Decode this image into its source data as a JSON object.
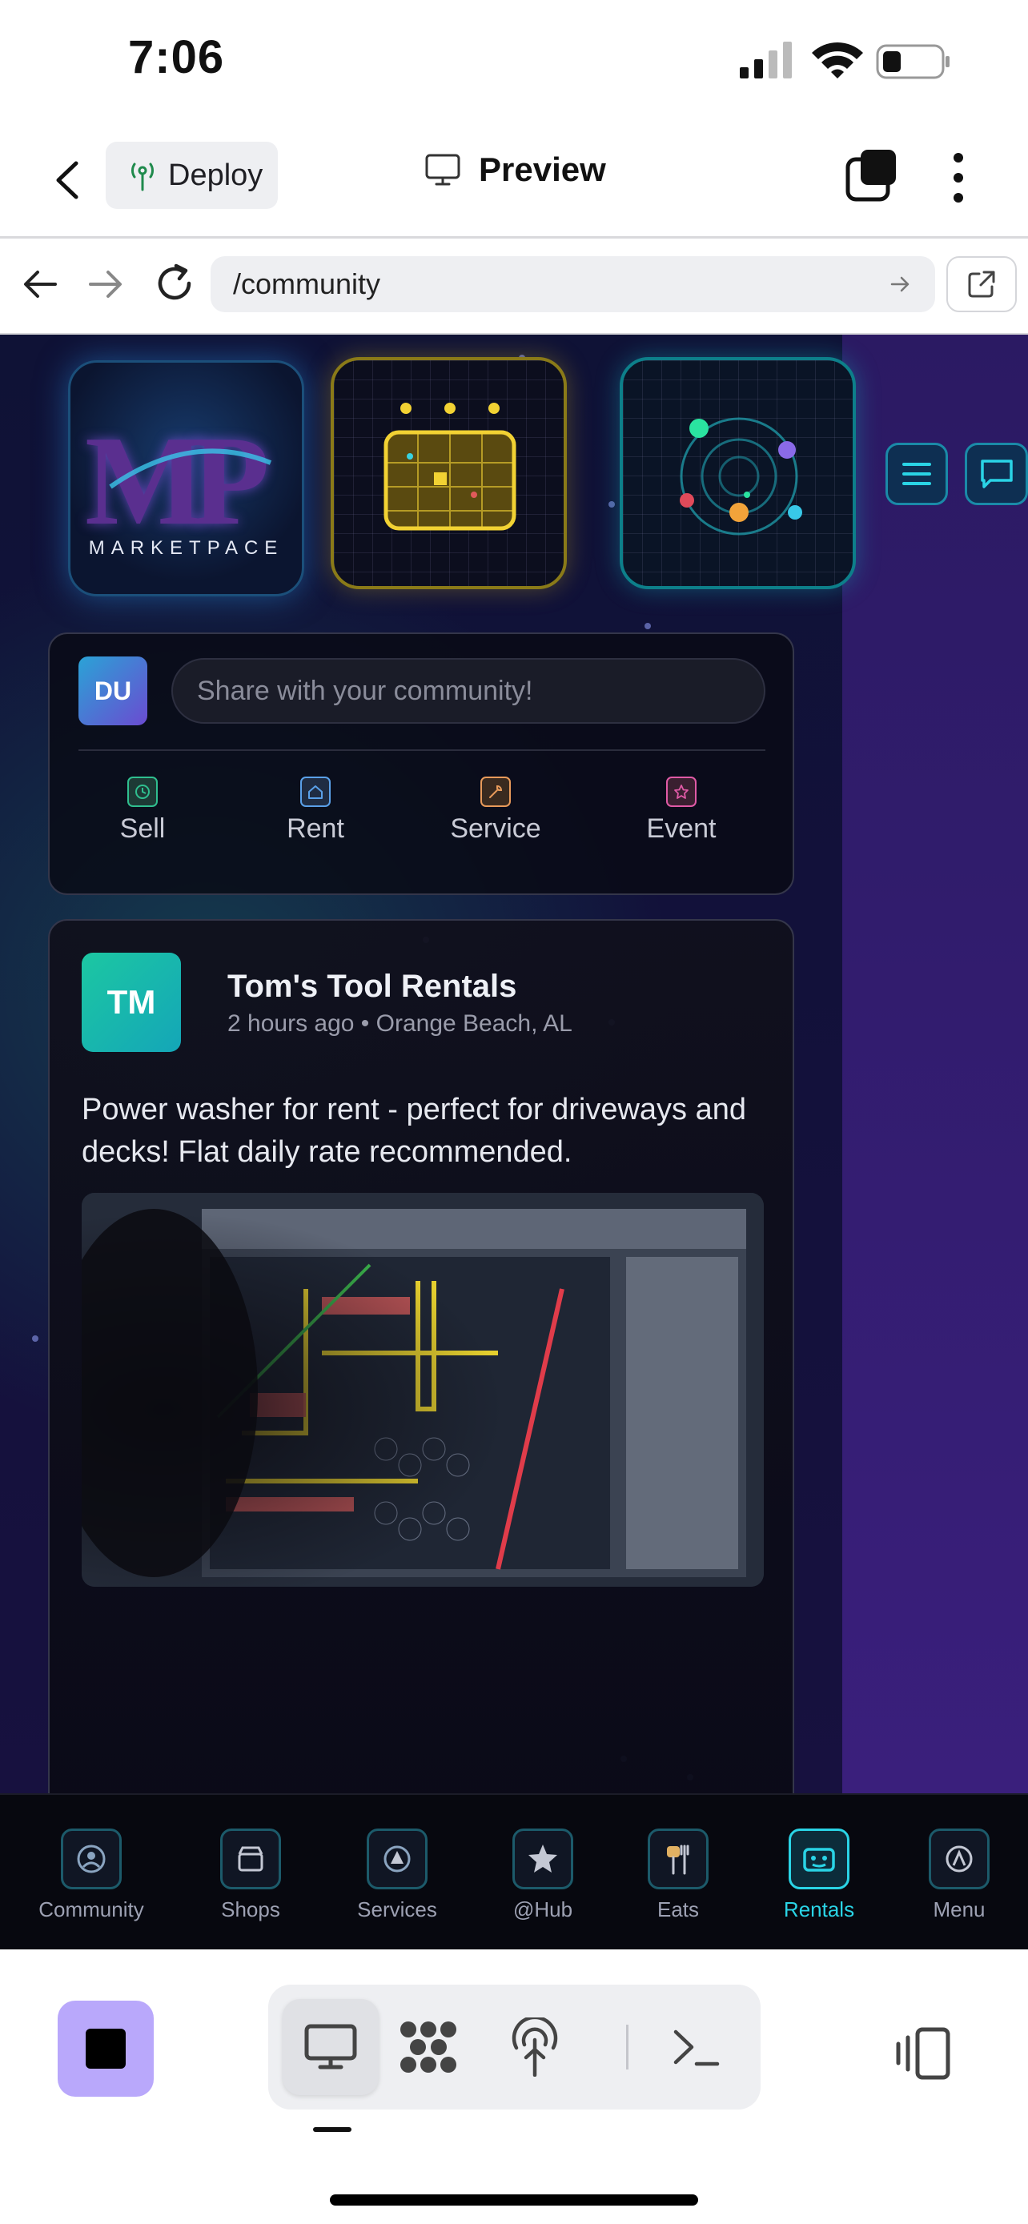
{
  "status_bar": {
    "time": "7:06"
  },
  "header": {
    "deploy_label": "Deploy",
    "preview_label": "Preview"
  },
  "url_bar": {
    "path": "/community"
  },
  "hero_tiles": {
    "logo_text": "MP",
    "logo_word": "MARKETPACE"
  },
  "composer": {
    "avatar_initials": "DU",
    "placeholder": "Share with your community!",
    "categories": [
      {
        "label": "Sell",
        "icon": "clock-icon",
        "color": "#2fbf8f"
      },
      {
        "label": "Rent",
        "icon": "home-icon",
        "color": "#5aa0e8"
      },
      {
        "label": "Service",
        "icon": "wrench-icon",
        "color": "#e89a5a"
      },
      {
        "label": "Event",
        "icon": "star-icon",
        "color": "#e05aa6"
      }
    ]
  },
  "post": {
    "avatar_initials": "TM",
    "author": "Tom's Tool Rentals",
    "meta": "2 hours ago • Orange Beach, AL",
    "body": "Power washer for rent - perfect for driveways and decks! Flat daily rate recommended."
  },
  "app_nav": {
    "items": [
      {
        "label": "Community",
        "icon": "people-icon",
        "active": false
      },
      {
        "label": "Shops",
        "icon": "shop-icon",
        "active": false
      },
      {
        "label": "Services",
        "icon": "services-icon",
        "active": false
      },
      {
        "label": "@Hub",
        "icon": "star-icon",
        "active": false
      },
      {
        "label": "Eats",
        "icon": "utensils-icon",
        "active": false
      },
      {
        "label": "Rentals",
        "icon": "rentals-icon",
        "active": true
      },
      {
        "label": "Menu",
        "icon": "menu-icon",
        "active": false
      }
    ]
  },
  "colors": {
    "accent": "#2ad4e6",
    "stop_button": "#b9a8fb",
    "brand_purple": "#5a2f8f"
  }
}
